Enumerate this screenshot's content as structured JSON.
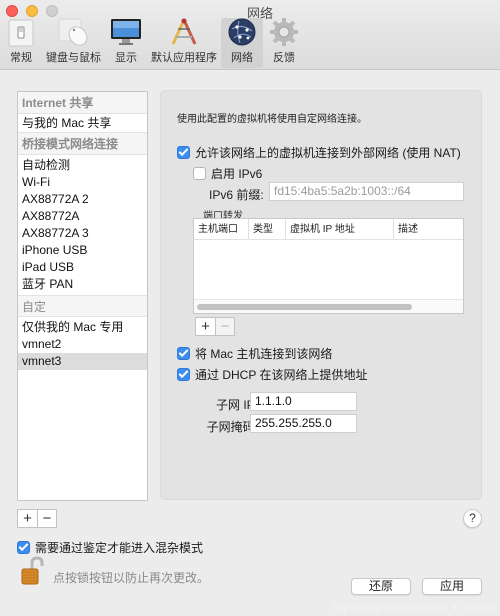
{
  "window": {
    "title": "网络",
    "traffic_lights": [
      "close",
      "minimize",
      "zoom"
    ]
  },
  "toolbar": {
    "items": [
      {
        "label": "常规",
        "icon": "general-switch-icon",
        "active": false
      },
      {
        "label": "键盘与鼠标",
        "icon": "keyboard-mouse-icon",
        "active": false
      },
      {
        "label": "显示",
        "icon": "display-icon",
        "active": false
      },
      {
        "label": "默认应用程序",
        "icon": "default-apps-icon",
        "active": false
      },
      {
        "label": "网络",
        "icon": "network-globe-icon",
        "active": true
      },
      {
        "label": "反馈",
        "icon": "feedback-gear-icon",
        "active": false
      }
    ]
  },
  "sidebar": {
    "sections": [
      {
        "header": "Internet 共享",
        "items": [
          "与我的 Mac 共享"
        ]
      },
      {
        "header": "桥接模式网络连接",
        "items": [
          "自动检测",
          "Wi-Fi",
          "AX88772A 2",
          "AX88772A",
          "AX88772A 3",
          "iPhone USB",
          "iPad USB",
          "蓝牙 PAN"
        ]
      },
      {
        "header": "自定",
        "items": [
          "仅供我的 Mac 专用",
          "vmnet2",
          "vmnet3"
        ]
      }
    ],
    "selected": "vmnet3",
    "add_label": "+",
    "remove_label": "−"
  },
  "panel": {
    "description": "使用此配置的虚拟机将使用自定网络连接。",
    "nat": {
      "label": "允许该网络上的虚拟机连接到外部网络 (使用 NAT)",
      "checked": true
    },
    "ipv6": {
      "label": "启用 IPv6",
      "checked": false
    },
    "ipv6_prefix": {
      "label": "IPv6 前缀:",
      "placeholder": "fd15:4ba5:5a2b:1003::/64"
    },
    "port_forwarding": {
      "label": "端口转发",
      "columns": [
        "主机端口",
        "类型",
        "虚拟机 IP 地址",
        "描述"
      ],
      "rows": [],
      "add_label": "+",
      "remove_label": "−"
    },
    "connect_host": {
      "label": "将 Mac 主机连接到该网络",
      "checked": true
    },
    "dhcp": {
      "label": "通过 DHCP 在该网络上提供地址",
      "checked": true
    },
    "subnet_ip": {
      "label": "子网 IP:",
      "value": "1.1.1.0"
    },
    "subnet_mask": {
      "label": "子网掩码:",
      "value": "255.255.255.0"
    }
  },
  "footer": {
    "help_label": "?",
    "promiscuous": {
      "label": "需要通过鉴定才能进入混杂模式",
      "checked": true
    },
    "lock_text": "点按锁按钮以防止再次更改。",
    "revert_label": "还原",
    "apply_label": "应用",
    "watermark": "https://blog.csdn.net/sinat_37757403"
  },
  "colors": {
    "accent": "#3b8ef0",
    "close": "#fc605b",
    "minimize": "#fdbc40",
    "selected_row": "#dcdcdc"
  }
}
